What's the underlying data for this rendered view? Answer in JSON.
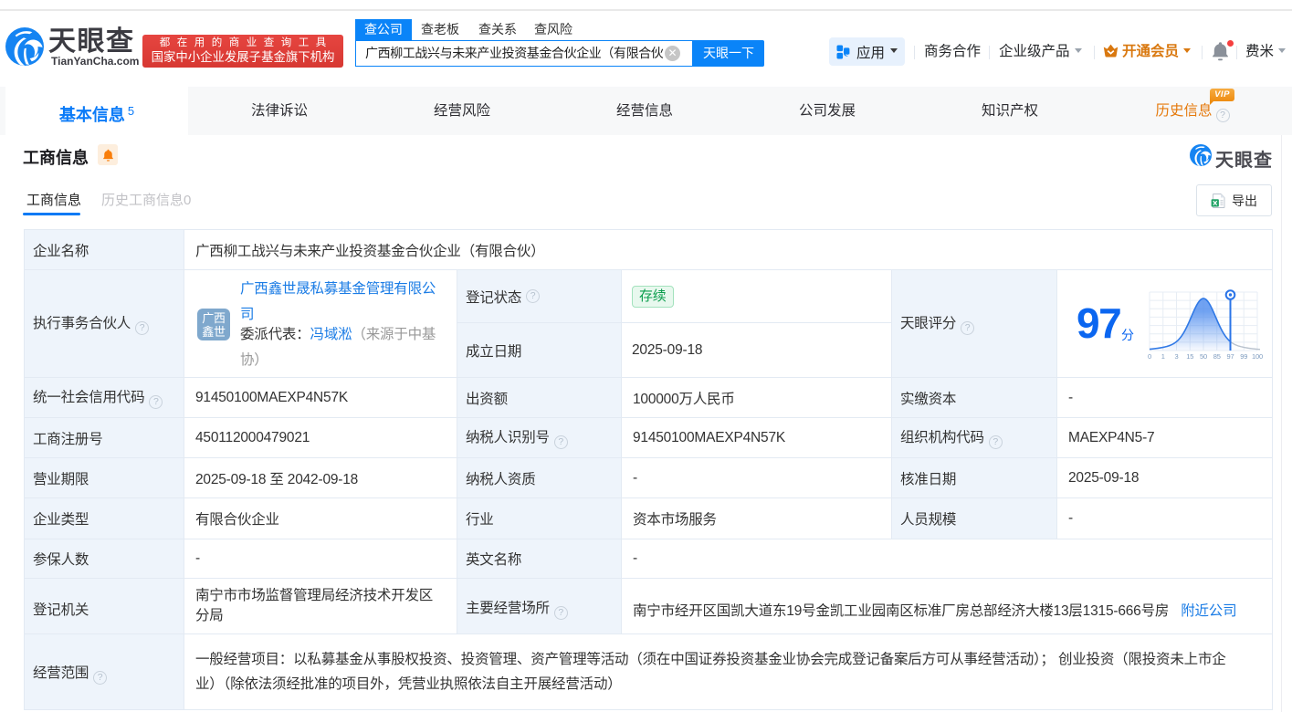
{
  "brand": {
    "name": "天眼查",
    "domain": "TianYanCha.com",
    "promo_line1": "都在用的商业查询工具",
    "promo_line2": "国家中小企业发展子基金旗下机构"
  },
  "search": {
    "tabs": [
      "查公司",
      "查老板",
      "查关系",
      "查风险"
    ],
    "active_tab": "查公司",
    "input_value": "广西柳工战兴与未来产业投资基金合伙企业（有限合伙",
    "button": "天眼一下"
  },
  "user_menu": {
    "apps": "应用",
    "cooperation": "商务合作",
    "enterprise": "企业级产品",
    "vip": "开通会员",
    "username": "费米"
  },
  "nav": {
    "tabs": [
      {
        "label": "基本信息",
        "badge": "5"
      },
      {
        "label": "法律诉讼"
      },
      {
        "label": "经营风险"
      },
      {
        "label": "经营信息"
      },
      {
        "label": "公司发展"
      },
      {
        "label": "知识产权"
      },
      {
        "label": "历史信息",
        "vip": "VIP"
      }
    ]
  },
  "section": {
    "title": "工商信息",
    "tab_active": "工商信息",
    "tab_inactive": "历史工商信息0",
    "export_label": "导出",
    "watermark": "天眼查"
  },
  "score": {
    "label": "天眼评分",
    "value": "97",
    "unit": "分",
    "ticks": [
      "0",
      "1",
      "3",
      "15",
      "50",
      "85",
      "97",
      "99",
      "100"
    ]
  },
  "chart_data": {
    "type": "area",
    "title": "天眼评分",
    "x": [
      0,
      1,
      3,
      15,
      50,
      85,
      97,
      99,
      100
    ],
    "marker_value": 97,
    "shape": "bell-curve",
    "score": 97
  },
  "fields": {
    "company_name": {
      "label": "企业名称",
      "value": "广西柳工战兴与未来产业投资基金合伙企业（有限合伙）"
    },
    "partner": {
      "label": "执行事务合伙人",
      "avatar_line1": "广西",
      "avatar_line2": "鑫世",
      "company_line1": "广西鑫世晟私募基金管理有限公",
      "company_line2": "司",
      "rep_prefix": "委派代表：",
      "rep_name": "冯域淞",
      "note_line1": "（来源于中基",
      "note_line2": "协）"
    },
    "reg_status": {
      "label": "登记状态",
      "value": "存续"
    },
    "est_date": {
      "label": "成立日期",
      "value": "2025-09-18"
    },
    "uscc": {
      "label": "统一社会信用代码",
      "value": "91450100MAEXP4N57K"
    },
    "capital": {
      "label": "出资额",
      "value": "100000万人民币"
    },
    "paid_capital": {
      "label": "实缴资本",
      "value": "-"
    },
    "reg_no": {
      "label": "工商注册号",
      "value": "450112000479021"
    },
    "taxpayer_id": {
      "label": "纳税人识别号",
      "value": "91450100MAEXP4N57K"
    },
    "org_code": {
      "label": "组织机构代码",
      "value": "MAEXP4N5-7"
    },
    "biz_term": {
      "label": "营业期限",
      "value": "2025-09-18 至 2042-09-18"
    },
    "taxpayer_qual": {
      "label": "纳税人资质",
      "value": "-"
    },
    "approval_date": {
      "label": "核准日期",
      "value": "2025-09-18"
    },
    "ent_type": {
      "label": "企业类型",
      "value": "有限合伙企业"
    },
    "industry": {
      "label": "行业",
      "value": "资本市场服务"
    },
    "staff_size": {
      "label": "人员规模",
      "value": "-"
    },
    "insured_count": {
      "label": "参保人数",
      "value": "-"
    },
    "english_name": {
      "label": "英文名称",
      "value": "-"
    },
    "reg_authority": {
      "label": "登记机关",
      "line1": "南宁市市场监督管理局经济技术开发区",
      "line2": "分局"
    },
    "address": {
      "label": "主要经营场所",
      "value": "南宁市经开区国凯大道东19号金凯工业园南区标准厂房总部经济大楼13层1315-666号房",
      "link": "附近公司"
    },
    "biz_scope": {
      "label": "经营范围",
      "line1": "一般经营项目：以私募基金从事股权投资、投资管理、资产管理等活动（须在中国证券投资基金业协会完成登记备案后方可从事经营活动）； 创业投资（限投资未上市企",
      "line2": "业）（除依法须经批准的项目外，凭营业执照依法自主开展经营活动）"
    }
  },
  "icons": {
    "question": "?",
    "clear": "✕"
  },
  "colors": {
    "brand_blue": "#0a84f8",
    "link_blue": "#0d7dff",
    "score_blue": "#0b66f0",
    "label_bg": "#eef4fb",
    "border": "#e3eaf3",
    "green_badge_text": "#0c9e4e",
    "orange_vip": "#d9780f",
    "red_promo": "#dd3d36"
  }
}
